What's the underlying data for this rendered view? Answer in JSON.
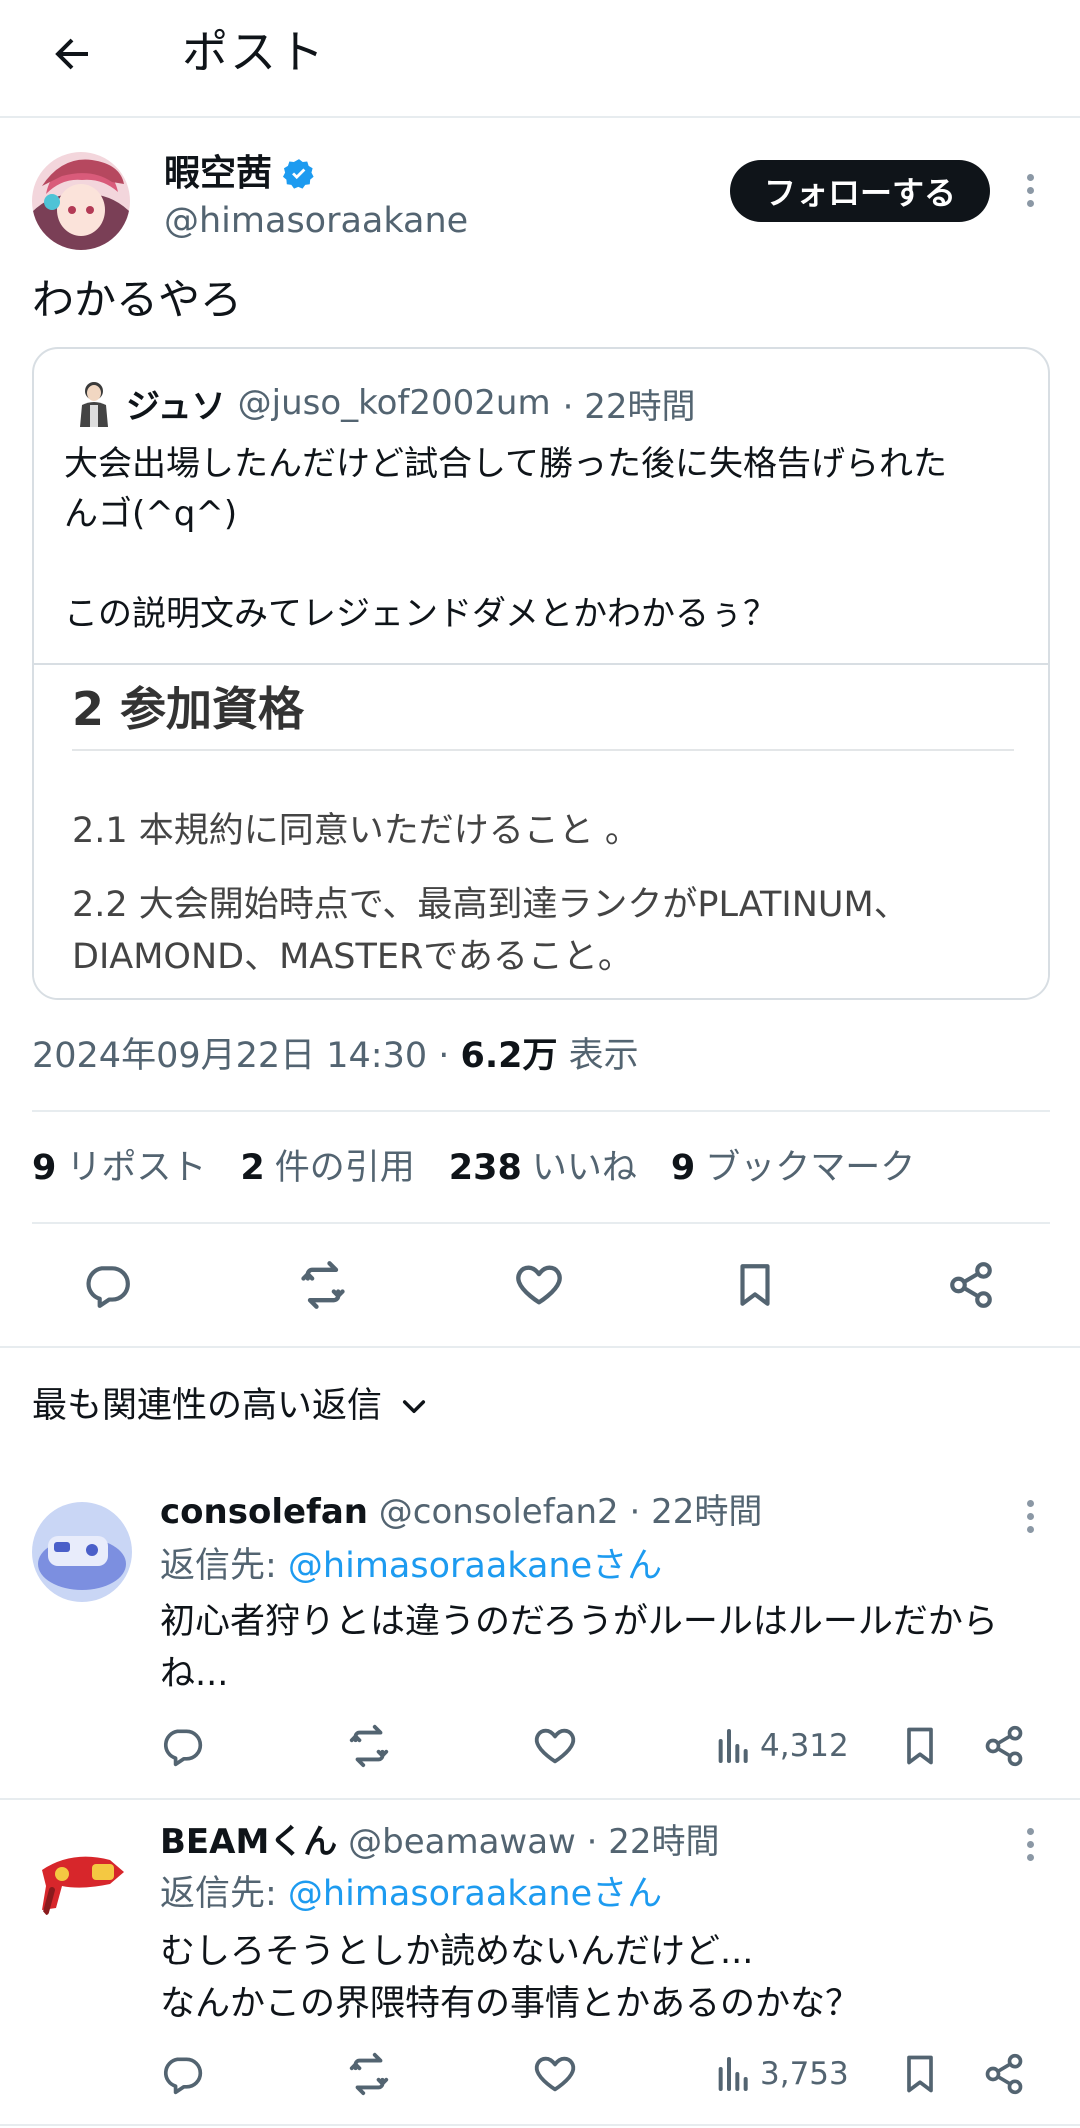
{
  "header": {
    "title": "ポスト"
  },
  "post": {
    "author": {
      "name": "暇空茜",
      "handle": "@himasoraakane"
    },
    "follow_label": "フォローする",
    "text": "わかるやろ",
    "quote": {
      "name": "ジュソ",
      "handle": "@juso_kof2002um",
      "time": "· 22時間",
      "text_lines": [
        "大会出場したんだけど試合して勝った後に失格告げられた",
        "んゴ(^q^)",
        "",
        "この説明文みてレジェンドダメとかわかるぅ？"
      ],
      "image": {
        "heading": "2 参加資格",
        "lines": [
          "2.1 本規約に同意いただけること 。",
          "2.2 大会開始時点で、最高到達ランクがPLATINUM、",
          "DIAMOND、MASTERであること。"
        ]
      }
    },
    "timestamp": "2024年09月22日 14:30 · ",
    "views_value": "6.2万",
    "views_label": "表示",
    "stats": [
      {
        "value": "9",
        "label": "リポスト"
      },
      {
        "value": "2",
        "label": "件の引用"
      },
      {
        "value": "238",
        "label": "いいね"
      },
      {
        "value": "9",
        "label": "ブックマーク"
      }
    ],
    "icons": [
      "reply-icon",
      "repost-icon",
      "like-icon",
      "bookmark-icon",
      "share-icon"
    ]
  },
  "sort": {
    "label": "最も関連性の高い返信"
  },
  "replies": [
    {
      "name": "consolefan",
      "handle": "@consolefan2",
      "time": "· 22時間",
      "replyto_prefix": "返信先: ",
      "replyto_mention": "@himasoraakaneさん",
      "text_lines": [
        "初心者狩りとは違うのだろうがルールはルールだから",
        "ね..."
      ],
      "views": "4,312"
    },
    {
      "name": "BEAMくん",
      "handle": "@beamawaw",
      "time": "· 22時間",
      "replyto_prefix": "返信先: ",
      "replyto_mention": "@himasoraakaneさん",
      "text_lines": [
        "むしろそうとしか読めないんだけど...",
        "なんかこの界隈特有の事情とかあるのかな？"
      ],
      "views": "3,753"
    }
  ],
  "colors": {
    "accent": "#1d9bf0",
    "text": "#0f1419",
    "muted": "#536471"
  }
}
